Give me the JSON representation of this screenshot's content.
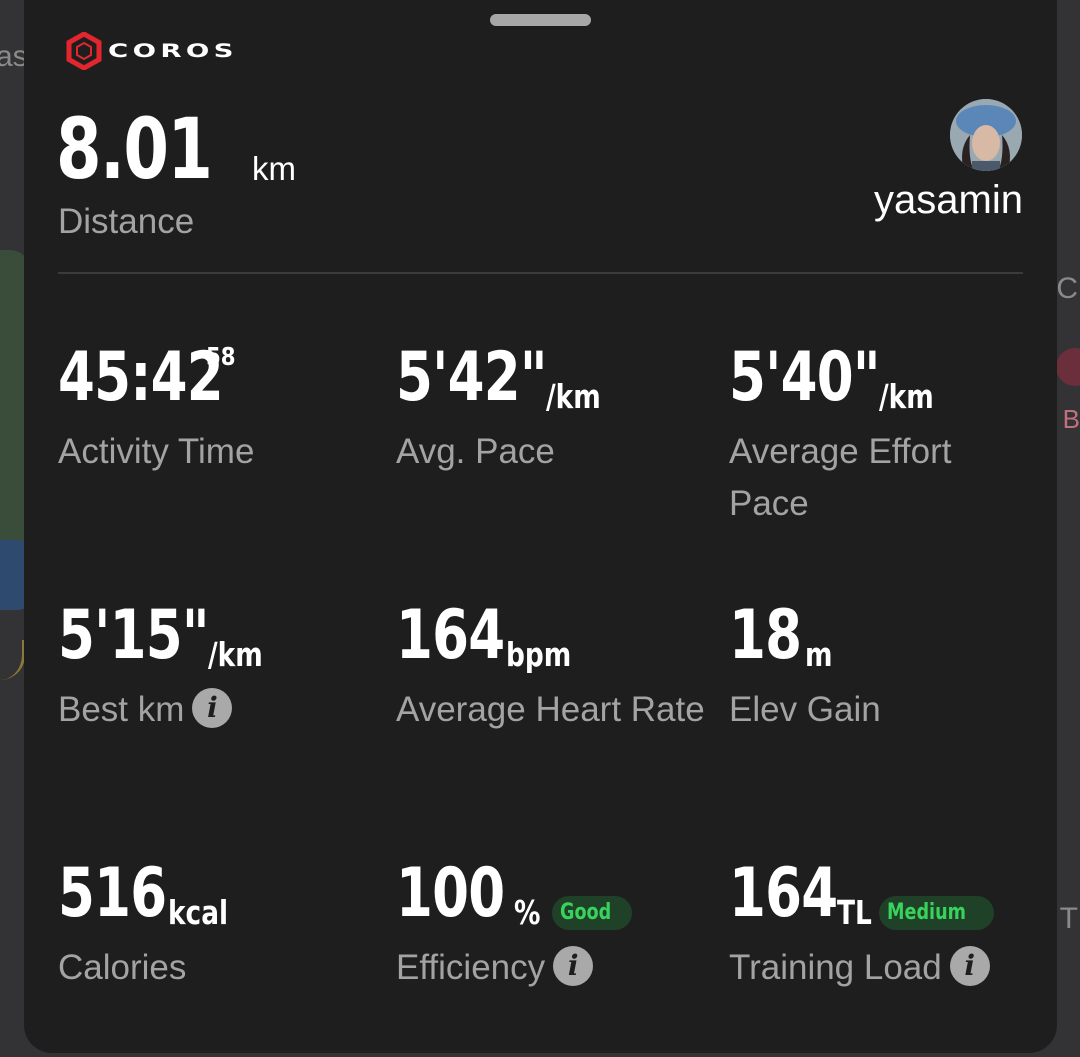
{
  "brand": {
    "name": "COROS",
    "accent_color": "#e3262e"
  },
  "header": {
    "distance_value": "8.01",
    "distance_unit": "km",
    "distance_label": "Distance",
    "username": "yasamin"
  },
  "metrics": [
    {
      "value": "45:42",
      "superscript": "58",
      "unit": "",
      "label": "Activity Time"
    },
    {
      "value": "5'42\"",
      "unit": "/km",
      "label": "Avg. Pace"
    },
    {
      "value": "5'40\"",
      "unit": "/km",
      "label": "Average Effort Pace"
    },
    {
      "value": "5'15\"",
      "unit": "/km",
      "label": "Best km",
      "has_info": true
    },
    {
      "value": "164",
      "unit": "bpm",
      "label": "Average Heart Rate"
    },
    {
      "value": "18",
      "unit": "m",
      "label": "Elev Gain"
    },
    {
      "value": "516",
      "unit": "kcal",
      "label": "Calories"
    },
    {
      "value": "100",
      "unit": "%",
      "badge": "Good",
      "label": "Efficiency",
      "has_info": true
    },
    {
      "value": "164",
      "unit": "TL",
      "badge": "Medium",
      "label": "Training Load",
      "has_info": true
    }
  ],
  "info_icon_glyph": "i",
  "map_labels": {
    "top_left": "as",
    "right_top": "C",
    "right_mid": "B",
    "right_bottom": "T"
  },
  "icons": {
    "info": "info-icon",
    "logo": "coros-hexagon-icon"
  },
  "colors": {
    "badge_green": "#38d25c",
    "badge_bg": "#1f4127",
    "label_gray": "#a3a3a3"
  }
}
